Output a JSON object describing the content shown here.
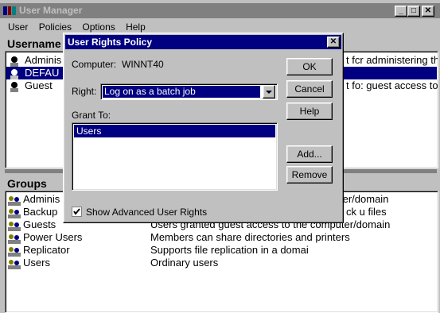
{
  "window": {
    "title": "User Manager",
    "min_glyph": "_",
    "max_glyph": "□",
    "close_glyph": "✕"
  },
  "menu": [
    "User",
    "Policies",
    "Options",
    "Help"
  ],
  "users_panel": {
    "header": "Username",
    "rows": [
      {
        "name": "Adminis",
        "description": "t fcr administering th"
      },
      {
        "name": "DEFAU",
        "description": ""
      },
      {
        "name": "Guest",
        "description": "t fo: guest access to"
      }
    ]
  },
  "groups_panel": {
    "header": "Groups",
    "rows": [
      {
        "name": "Adminis",
        "description": "ter/domain"
      },
      {
        "name": "Backup",
        "description": "ck u files"
      },
      {
        "name": "Guests",
        "description": "Users granted guest access to the computer/domain"
      },
      {
        "name": "Power Users",
        "description": "Members can share directories and printers"
      },
      {
        "name": "Replicator",
        "description": "Supports file replication in a domai"
      },
      {
        "name": "Users",
        "description": "Ordinary users"
      }
    ]
  },
  "dialog": {
    "title": "User Rights Policy",
    "close_glyph": "✕",
    "computer_label": "Computer:",
    "computer_value": "WINNT40",
    "right_label": "Right:",
    "right_value": "Log on as a batch job",
    "grant_label": "Grant To:",
    "grant_list": [
      "Users"
    ],
    "checkbox_label": "Show Advanced User Rights",
    "checkbox_checked": true,
    "buttons": {
      "ok": "OK",
      "cancel": "Cancel",
      "help": "Help",
      "add": "Add...",
      "remove": "Remove"
    }
  },
  "colors": {
    "selection": "#000080",
    "inactive_title": "#808080",
    "face": "#c0c0c0"
  }
}
